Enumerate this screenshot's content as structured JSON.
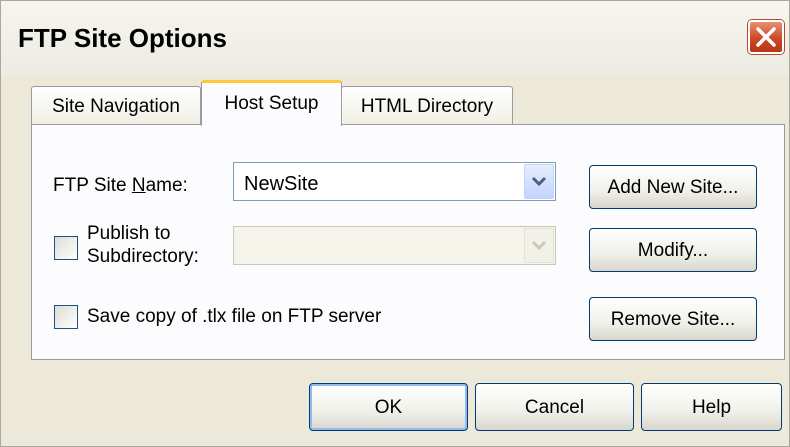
{
  "window": {
    "title": "FTP Site Options",
    "close_icon": "close-icon"
  },
  "tabs": [
    {
      "label": "Site Navigation",
      "selected": false
    },
    {
      "label": "Host Setup",
      "selected": true
    },
    {
      "label": "HTML Directory",
      "selected": false
    }
  ],
  "host_setup": {
    "site_name_label_pre": "FTP Site ",
    "site_name_label_mnemonic": "N",
    "site_name_label_post": "ame:",
    "site_name_value": "NewSite",
    "publish_label_line1": "Publish to",
    "publish_label_line2": "Subdirectory:",
    "publish_checked": false,
    "subdirectory_value": "",
    "save_copy_label": "Save copy of .tlx file on FTP server",
    "save_copy_checked": false,
    "add_new_site_label": "Add New Site...",
    "modify_label": "Modify...",
    "remove_site_label": "Remove Site..."
  },
  "footer": {
    "ok_label": "OK",
    "cancel_label": "Cancel",
    "help_label": "Help"
  },
  "colors": {
    "dialog_bg": "#ece9d8",
    "panel_bg": "#fcfcfe",
    "selected_tab_accent": "#ffc83c",
    "close_button": "#cc4a28"
  }
}
